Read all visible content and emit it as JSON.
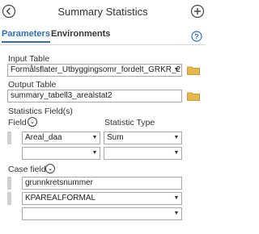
{
  "header": {
    "title": "Summary Statistics"
  },
  "tabs": {
    "parameters": "Parameters",
    "environments": "Environments"
  },
  "input_table": {
    "label": "Input Table",
    "value": "Formålsflater_Utbyggingsomr_fordelt_GRKR_2"
  },
  "output_table": {
    "label": "Output Table",
    "value": "summary_tabell3_arealstat2"
  },
  "statistics": {
    "section_label": "Statistics Field(s)",
    "field_header": "Field",
    "type_header": "Statistic Type",
    "rows": [
      {
        "field": "Areal_daa",
        "type": "Sum"
      },
      {
        "field": "",
        "type": ""
      }
    ]
  },
  "case_field": {
    "label": "Case field",
    "items": [
      "grunnkretsnummer",
      "KPAREALFORMAL",
      ""
    ]
  },
  "colors": {
    "accent": "#2f6fb5",
    "folder": "#e8b84a"
  },
  "icons": {
    "back": "back-arrow-icon",
    "add": "plus-icon",
    "help": "help-icon",
    "folder": "folder-icon",
    "dropdown": "chevron-down-icon"
  }
}
